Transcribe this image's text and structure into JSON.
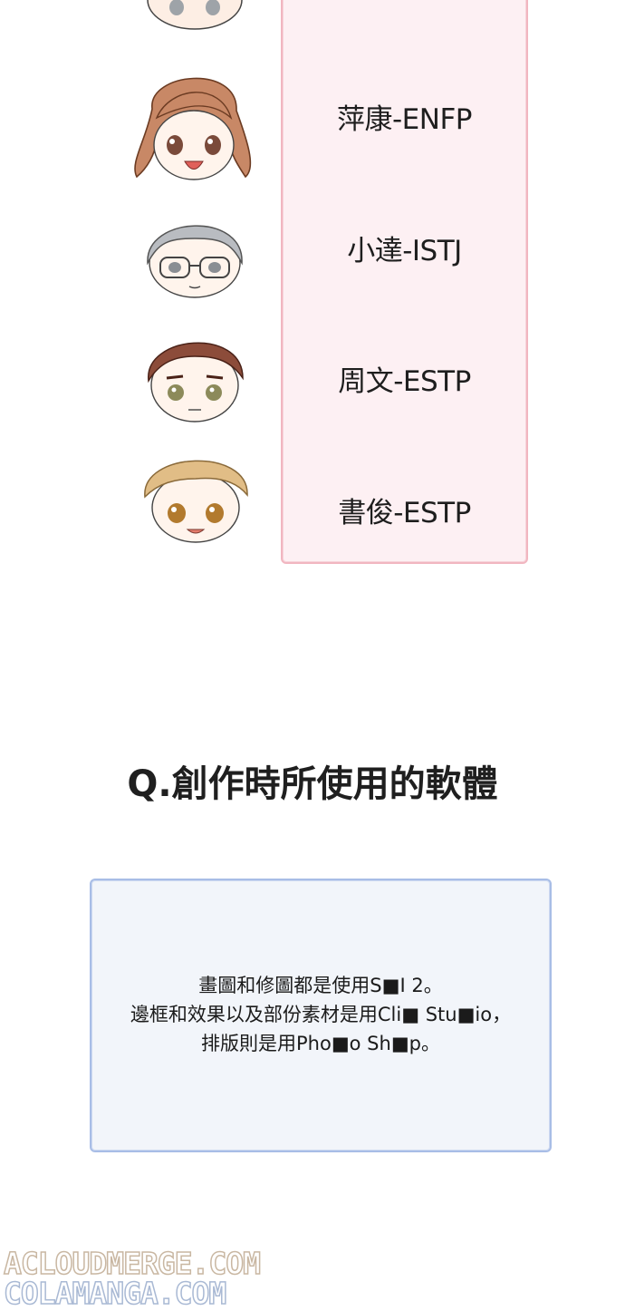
{
  "characters": [
    {
      "name_label": "萍康-ENFP",
      "hair": "brown-long"
    },
    {
      "name_label": "小達-ISTJ",
      "hair": "gray-glasses"
    },
    {
      "name_label": "周文-ESTP",
      "hair": "dark-brown"
    },
    {
      "name_label": "書俊-ESTP",
      "hair": "blonde"
    }
  ],
  "question": {
    "title": "Q.創作時所使用的軟體"
  },
  "answer": {
    "lines": [
      "畫圖和修圖都是使用S■I 2。",
      "邊框和效果以及部份素材是用Cli■ Stu■io，",
      "排版則是用Pho■o Sh■p。"
    ]
  },
  "watermark": {
    "line1": "ACLOUDMERGE.COM",
    "line2": "COLAMANGA.COM"
  },
  "colors": {
    "pink_panel_bg": "#fdf0f3",
    "pink_panel_border": "#f1b6c0",
    "blue_panel_bg": "#f2f5fa",
    "blue_panel_border": "#a8bde6"
  }
}
